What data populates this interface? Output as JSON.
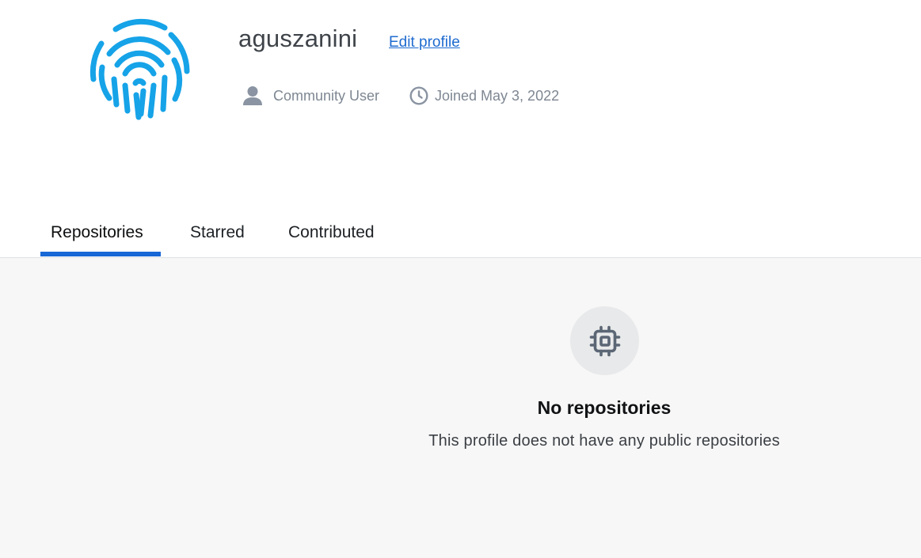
{
  "profile": {
    "username": "aguszanini",
    "edit_label": "Edit profile",
    "avatar_icon": "fingerprint-icon",
    "role": "Community User",
    "role_icon": "user-icon",
    "joined": "Joined May 3, 2022",
    "joined_icon": "clock-icon"
  },
  "tabs": [
    {
      "label": "Repositories",
      "active": true
    },
    {
      "label": "Starred",
      "active": false
    },
    {
      "label": "Contributed",
      "active": false
    }
  ],
  "empty_state": {
    "icon": "chip-icon",
    "title": "No repositories",
    "description": "This profile does not have any public repositories"
  },
  "colors": {
    "accent": "#1867d6",
    "link": "#1f6bd0",
    "avatar": "#16a3e8",
    "muted_text": "#7e8792",
    "panel_bg": "#f7f7f7"
  }
}
